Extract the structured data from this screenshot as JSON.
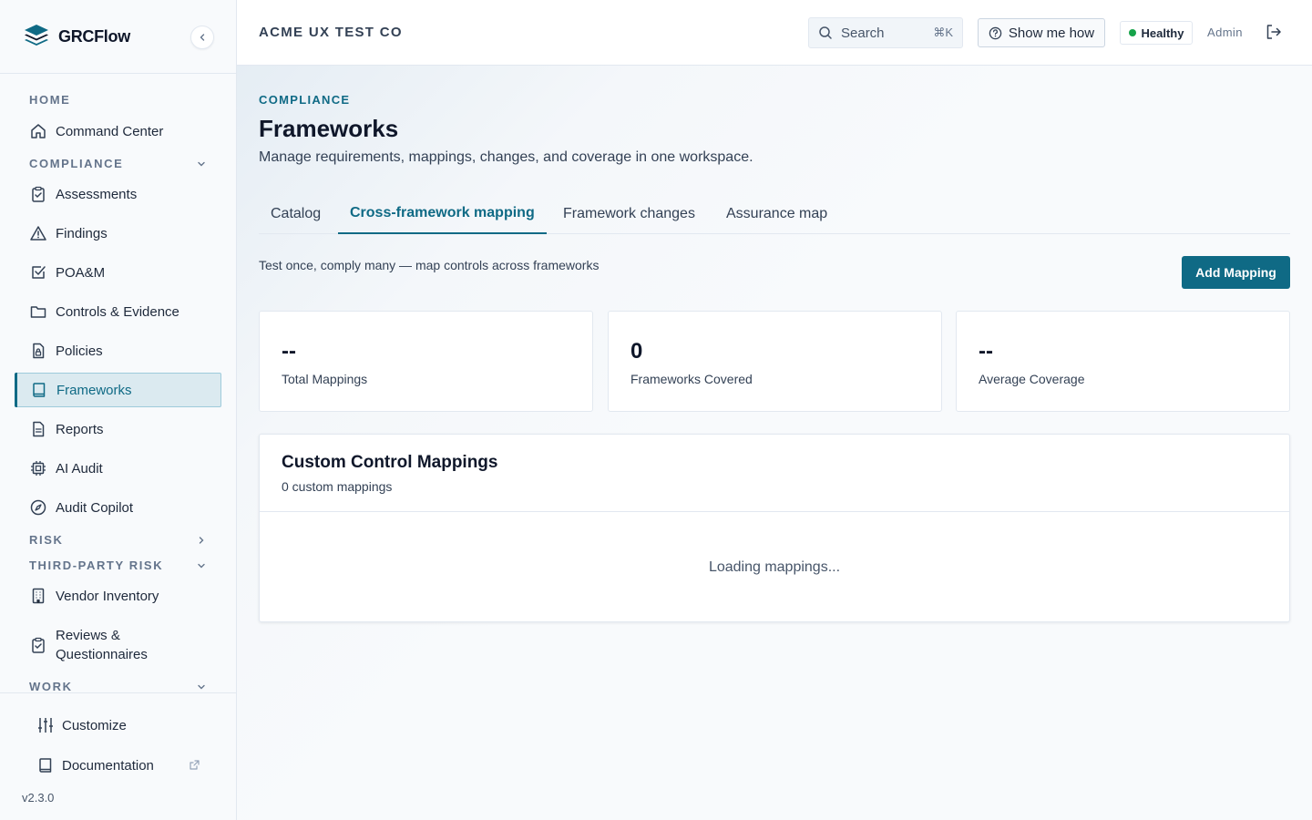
{
  "app": {
    "name": "GRCFlow",
    "version": "v2.3.0"
  },
  "colors": {
    "accent": "#0f6a85",
    "healthy": "#16a34a"
  },
  "sidebar": {
    "sections": {
      "home": "HOME",
      "compliance": "COMPLIANCE",
      "risk": "RISK",
      "third_party_risk": "THIRD-PARTY RISK",
      "work": "WORK"
    },
    "items": {
      "command_center": "Command Center",
      "assessments": "Assessments",
      "findings": "Findings",
      "poam": "POA&M",
      "controls_evidence": "Controls & Evidence",
      "policies": "Policies",
      "frameworks": "Frameworks",
      "reports": "Reports",
      "ai_audit": "AI Audit",
      "audit_copilot": "Audit Copilot",
      "vendor_inventory": "Vendor Inventory",
      "reviews_questionnaires": "Reviews & Questionnaires"
    },
    "active_item": "Frameworks",
    "footer": {
      "customize": "Customize",
      "documentation": "Documentation"
    }
  },
  "topbar": {
    "org_name": "ACME UX TEST CO",
    "search_placeholder": "Search",
    "search_shortcut": "⌘K",
    "show_me_how": "Show me how",
    "health_status": "Healthy",
    "user_role": "Admin"
  },
  "page": {
    "eyebrow": "COMPLIANCE",
    "title": "Frameworks",
    "subtitle": "Manage requirements, mappings, changes, and coverage in one workspace.",
    "tabs": [
      "Catalog",
      "Cross-framework mapping",
      "Framework changes",
      "Assurance map"
    ],
    "active_tab": "Cross-framework mapping",
    "tab_description": "Test once, comply many — map controls across frameworks",
    "add_button": "Add Mapping",
    "stats": [
      {
        "value": "--",
        "label": "Total Mappings"
      },
      {
        "value": "0",
        "label": "Frameworks Covered"
      },
      {
        "value": "--",
        "label": "Average Coverage"
      }
    ],
    "panel": {
      "title": "Custom Control Mappings",
      "subtitle": "0 custom mappings",
      "loading_text": "Loading mappings..."
    }
  }
}
